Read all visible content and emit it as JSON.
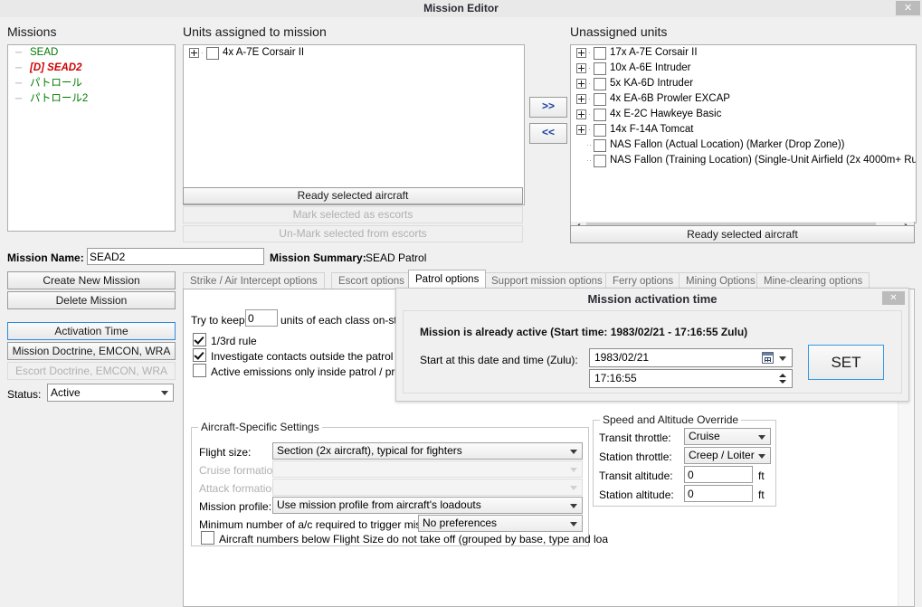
{
  "window": {
    "title": "Mission Editor",
    "close_label": "✕"
  },
  "missions_panel": {
    "label": "Missions",
    "items": [
      {
        "label": "SEAD",
        "color": "green"
      },
      {
        "label": "[D] SEAD2",
        "color": "red"
      },
      {
        "label": "パトロール",
        "color": "green"
      },
      {
        "label": "パトロール2",
        "color": "green"
      }
    ]
  },
  "assigned_panel": {
    "label": "Units assigned to mission",
    "items": [
      {
        "label": "4x A-7E Corsair II",
        "expandable": true
      }
    ],
    "buttons": [
      {
        "label": "Ready selected aircraft",
        "enabled": true
      },
      {
        "label": "Mark selected as escorts",
        "enabled": false
      },
      {
        "label": "Un-Mark selected from escorts",
        "enabled": false
      }
    ]
  },
  "transfer": {
    "assign_label": ">>",
    "unassign_label": "<<"
  },
  "unassigned_panel": {
    "label": "Unassigned units",
    "items": [
      {
        "label": "17x A-7E Corsair II",
        "expandable": true
      },
      {
        "label": "10x A-6E Intruder",
        "expandable": true
      },
      {
        "label": "5x KA-6D Intruder",
        "expandable": true
      },
      {
        "label": "4x EA-6B Prowler EXCAP",
        "expandable": true
      },
      {
        "label": "4x E-2C Hawkeye Basic",
        "expandable": true
      },
      {
        "label": "14x F-14A Tomcat",
        "expandable": true
      },
      {
        "label": "NAS Fallon (Actual Location) (Marker (Drop Zone))",
        "expandable": false
      },
      {
        "label": "NAS Fallon (Training Location) (Single-Unit Airfield (2x 4000m+ Runwa",
        "expandable": false
      }
    ],
    "ready_button": "Ready selected aircraft"
  },
  "mission_form": {
    "name_label": "Mission Name:",
    "name_value": "SEAD2",
    "name_placeholder": "",
    "summary_label": "Mission Summary:",
    "summary_value": "SEAD Patrol",
    "buttons": [
      {
        "label": "Create New Mission",
        "enabled": true
      },
      {
        "label": "Delete Mission",
        "enabled": true
      },
      {
        "label": "Activation Time",
        "enabled": true,
        "focused": true
      },
      {
        "label": "Mission Doctrine, EMCON, WRA",
        "enabled": true
      },
      {
        "label": "Escort Doctrine, EMCON, WRA",
        "enabled": false
      }
    ],
    "status_label": "Status:",
    "status_value": "Active"
  },
  "tabs": [
    {
      "label": "Strike / Air Intercept options",
      "active": false
    },
    {
      "label": "Escort options",
      "active": false
    },
    {
      "label": "Patrol options",
      "active": true
    },
    {
      "label": "Support mission options",
      "active": false
    },
    {
      "label": "Ferry options",
      "active": false
    },
    {
      "label": "Mining Options",
      "active": false
    },
    {
      "label": "Mine-clearing options",
      "active": false
    }
  ],
  "patrol_options": {
    "keep_prefix": "Try to keep",
    "keep_value": "0",
    "keep_suffix": "units of each class on-sta",
    "checkboxes": [
      {
        "label": "1/3rd rule",
        "checked": true
      },
      {
        "label": "Investigate contacts outside the patrol ar",
        "checked": true
      },
      {
        "label": "Active emissions only inside patrol / pro",
        "checked": false
      }
    ]
  },
  "aircraft_settings": {
    "legend": "Aircraft-Specific Settings",
    "flight_size_label": "Flight size:",
    "flight_size_value": "Section (2x aircraft), typical for fighters",
    "cruise_formation_label": "Cruise formation",
    "cruise_formation_value": "",
    "attack_formation_label": "Attack formation",
    "attack_formation_value": "",
    "mission_profile_label": "Mission profile:",
    "mission_profile_value": "Use mission profile from aircraft's loadouts",
    "min_ac_label": "Minimum number of a/c required to trigger miss",
    "min_ac_value": "No preferences",
    "below_flight_size_label": "Aircraft numbers below Flight Size do not take off (grouped by base, type and loa",
    "below_flight_size_checked": false
  },
  "speed_altitude": {
    "legend": "Speed and Altitude Override",
    "transit_throttle_label": "Transit throttle:",
    "transit_throttle_value": "Cruise",
    "station_throttle_label": "Station throttle:",
    "station_throttle_value": "Creep / Loiter",
    "transit_altitude_label": "Transit altitude:",
    "transit_altitude_value": "0",
    "transit_altitude_unit": "ft",
    "station_altitude_label": "Station altitude:",
    "station_altitude_value": "0",
    "station_altitude_unit": "ft"
  },
  "dialog": {
    "title": "Mission activation time",
    "close_label": "✕",
    "active_note": "Mission is already active (Start time: 1983/02/21 - 17:16:55 Zulu)",
    "start_label": "Start at this date and time (Zulu):",
    "date_value": "1983/02/21",
    "time_value": "17:16:55",
    "set_label": "SET"
  },
  "colors": {
    "accent": "#2f8ae0",
    "mission_green": "#007a00",
    "mission_red": "#d10000",
    "window_bg": "#f0f0f0"
  }
}
